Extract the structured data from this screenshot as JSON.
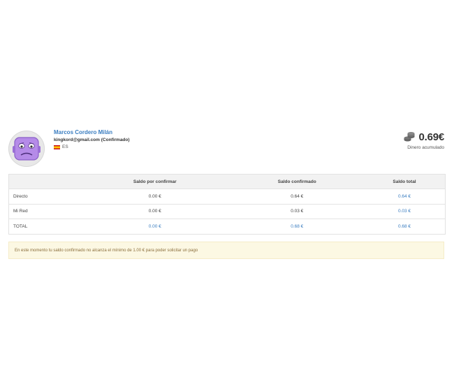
{
  "user": {
    "name": "Marcos Cordero Milán",
    "email": "kingkord@gmail.com (Confirmado)",
    "language": "ES"
  },
  "balance": {
    "amount": "0.69€",
    "caption": "Dinero acumulado",
    "icon": "coins-stack-icon"
  },
  "table": {
    "headers": [
      "",
      "Saldo por confirmar",
      "Saldo confirmado",
      "Saldo total"
    ],
    "rows": [
      {
        "label": "Directo",
        "pending": "0.00 €",
        "confirmed": "0.64 €",
        "total": "0.64 €"
      },
      {
        "label": "Mi Red",
        "pending": "0.00 €",
        "confirmed": "0.03 €",
        "total": "0.03 €"
      },
      {
        "label": "TOTAL",
        "pending": "0.00 €",
        "confirmed": "0.68 €",
        "total": "0.68 €"
      }
    ]
  },
  "alert": {
    "message": "En este momento tu saldo confirmado no alcanza el mínimo de 1.00 € para poder solicitar un pago"
  },
  "colors": {
    "link": "#3a7dc0",
    "alert_bg": "#fcf8e3",
    "alert_text": "#8a6d3b",
    "avatar_purple": "#b58be8"
  }
}
